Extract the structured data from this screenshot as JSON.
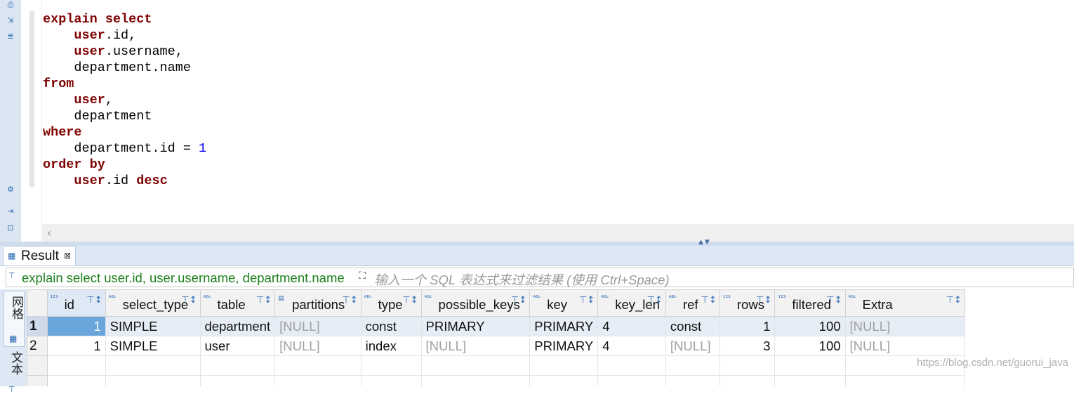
{
  "editor": {
    "code_lines": [
      [
        {
          "t": "explain select",
          "k": "kw"
        }
      ],
      [
        {
          "t": "    "
        },
        {
          "t": "user",
          "k": "kw"
        },
        {
          "t": ".id,"
        }
      ],
      [
        {
          "t": "    "
        },
        {
          "t": "user",
          "k": "kw"
        },
        {
          "t": ".username,"
        }
      ],
      [
        {
          "t": "    department.name"
        }
      ],
      [
        {
          "t": "from",
          "k": "kw"
        }
      ],
      [
        {
          "t": "    "
        },
        {
          "t": "user",
          "k": "kw"
        },
        {
          "t": ","
        }
      ],
      [
        {
          "t": "    department"
        }
      ],
      [
        {
          "t": "where",
          "k": "kw"
        }
      ],
      [
        {
          "t": "    department.id = "
        },
        {
          "t": "1",
          "k": "num"
        }
      ],
      [
        {
          "t": "order by",
          "k": "kw"
        }
      ],
      [
        {
          "t": "    "
        },
        {
          "t": "user",
          "k": "kw"
        },
        {
          "t": ".id "
        },
        {
          "t": "desc",
          "k": "kw"
        }
      ]
    ],
    "scroll_left_icon": "chevron-left-icon"
  },
  "result_tab": {
    "label": "Result",
    "close": "⊠"
  },
  "filter": {
    "query": "explain select user.id, user.username, department.name",
    "placeholder": "输入一个 SQL 表达式来过滤结果 (使用 Ctrl+Space)"
  },
  "side_tabs": {
    "grid": "网格",
    "text": "文本"
  },
  "columns": [
    {
      "name": "id",
      "type": "123"
    },
    {
      "name": "select_type",
      "type": "ABC"
    },
    {
      "name": "table",
      "type": "ABC"
    },
    {
      "name": "partitions",
      "type": "doc"
    },
    {
      "name": "type",
      "type": "ABC"
    },
    {
      "name": "possible_keys",
      "type": "ABC"
    },
    {
      "name": "key",
      "type": "ABC"
    },
    {
      "name": "key_len",
      "type": "ABC"
    },
    {
      "name": "ref",
      "type": "ABC"
    },
    {
      "name": "rows",
      "type": "123"
    },
    {
      "name": "filtered",
      "type": "123"
    },
    {
      "name": "Extra",
      "type": "ABC"
    }
  ],
  "rows": [
    {
      "num": "1",
      "cells": [
        "1",
        "SIMPLE",
        "department",
        "[NULL]",
        "const",
        "PRIMARY",
        "PRIMARY",
        "4",
        "const",
        "1",
        "100",
        "[NULL]"
      ]
    },
    {
      "num": "2",
      "cells": [
        "1",
        "SIMPLE",
        "user",
        "[NULL]",
        "index",
        "[NULL]",
        "PRIMARY",
        "4",
        "[NULL]",
        "3",
        "100",
        "[NULL]"
      ]
    }
  ],
  "watermark": "https://blog.csdn.net/guorui_java",
  "colors": {
    "keyword": "#7f0000",
    "number": "#0000ff",
    "filter_query": "#1a7f1a",
    "selection": "#6aa6dc"
  }
}
